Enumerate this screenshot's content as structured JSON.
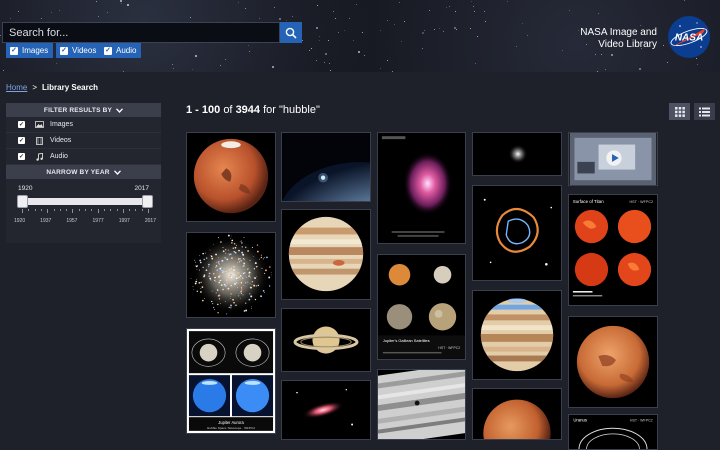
{
  "search": {
    "placeholder": "Search for...",
    "value": ""
  },
  "type_filters": [
    {
      "label": "Images",
      "checked": true
    },
    {
      "label": "Videos",
      "checked": true
    },
    {
      "label": "Audio",
      "checked": true
    }
  ],
  "brand": {
    "line1": "NASA Image and",
    "line2": "Video Library",
    "logo_text": "NASA"
  },
  "breadcrumb": {
    "home": "Home",
    "separator": ">",
    "current": "Library Search"
  },
  "sidebar": {
    "filter_header": "FILTER RESULTS BY",
    "filters": [
      {
        "label": "Images",
        "icon": "image-icon",
        "checked": true
      },
      {
        "label": "Videos",
        "icon": "film-icon",
        "checked": true
      },
      {
        "label": "Audio",
        "icon": "music-note-icon",
        "checked": true
      }
    ],
    "year_header": "NARROW BY YEAR",
    "year_min": "1920",
    "year_max": "2017",
    "tick_labels": [
      "1920",
      "1937",
      "1957",
      "1977",
      "1997",
      "2017"
    ]
  },
  "results": {
    "range": "1 - 100",
    "of_word": "of",
    "total": "3944",
    "for_word": "for",
    "query": "\"hubble\""
  },
  "thumb_text": {
    "titan_title": "Surface of Titan",
    "titan_inst": "HST · WFPC2",
    "galilean_title": "Jupiter's Galilean Satellites",
    "galilean_inst": "HST · WFPC2",
    "aurora_title": "Jupiter Aurora",
    "aurora_sub": "Hubble Space Telescope · WFPC2",
    "uranus_title": "Uranus",
    "uranus_inst": "HST · WFPC2"
  },
  "colors": {
    "accent": "#2463b5",
    "background": "#1e2129",
    "panel": "#3b3f4c"
  }
}
